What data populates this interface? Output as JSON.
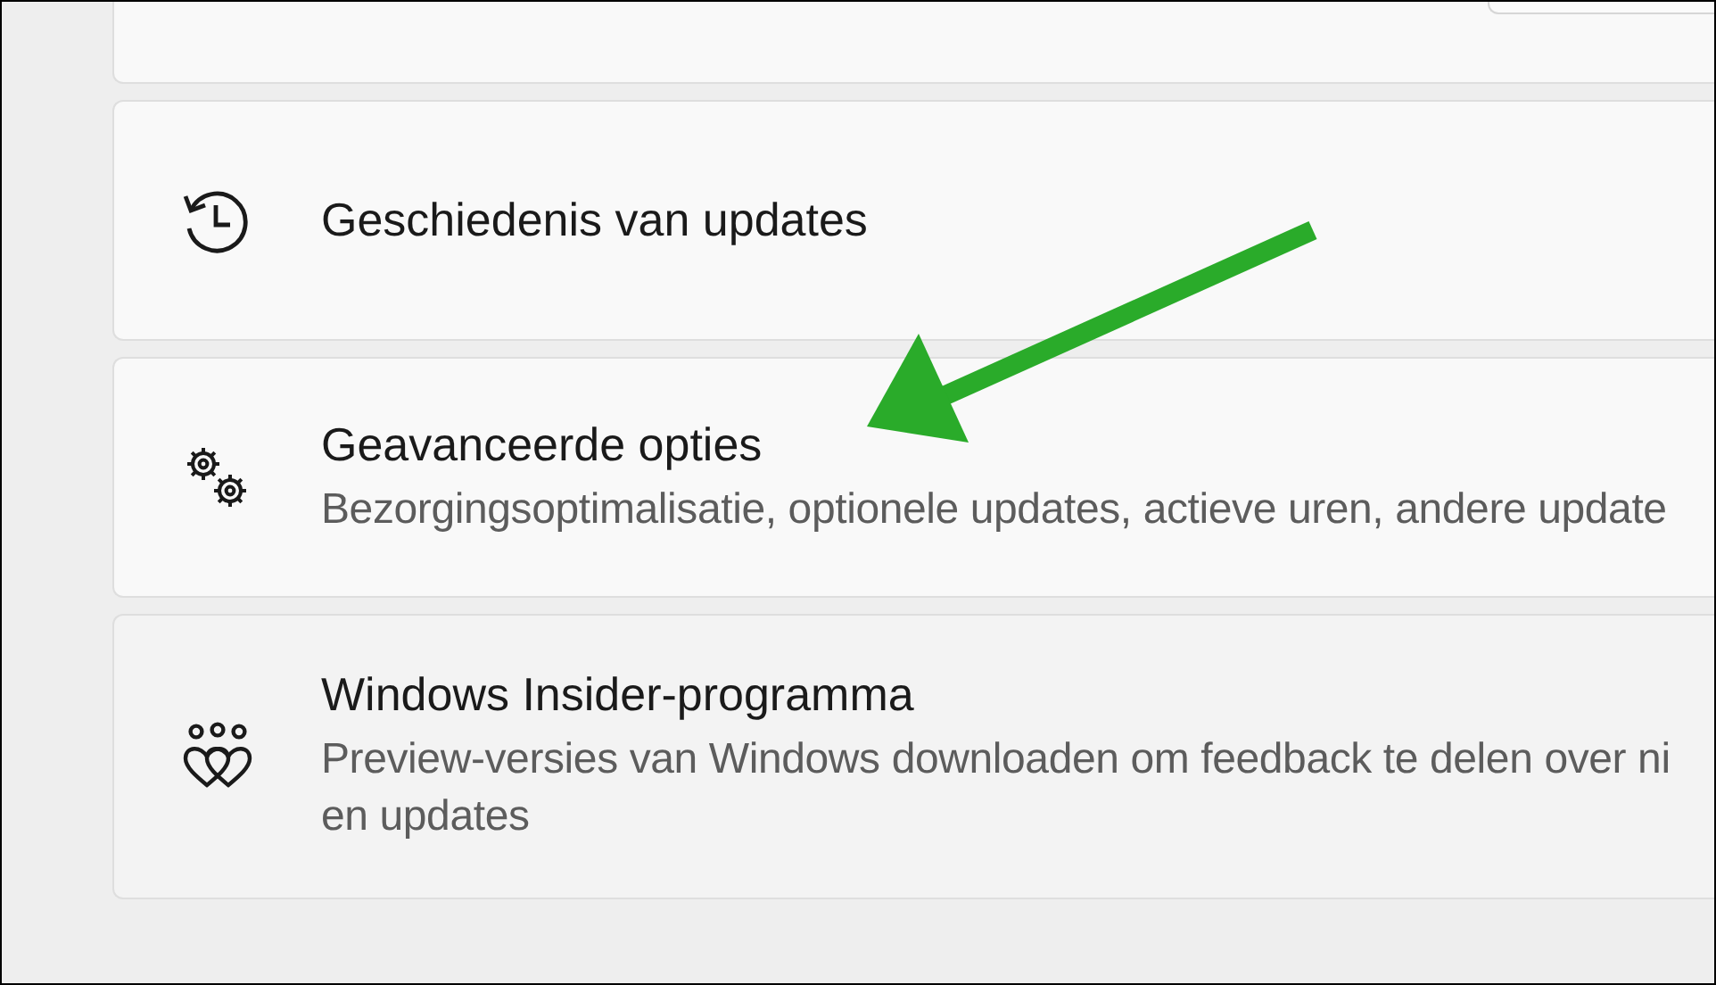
{
  "cards": [
    {
      "kind": "partial"
    },
    {
      "kind": "link",
      "title": "Geschiedenis van updates",
      "hovered": false
    },
    {
      "kind": "link",
      "title": "Geavanceerde opties",
      "description": [
        "Bezorgingsoptimalisatie, optionele updates, actieve uren, andere update"
      ],
      "hovered": false
    },
    {
      "kind": "link",
      "title": "Windows Insider-programma",
      "description": [
        "Preview-versies van Windows downloaden om feedback te delen over ni",
        "en updates"
      ],
      "hovered": true
    }
  ]
}
